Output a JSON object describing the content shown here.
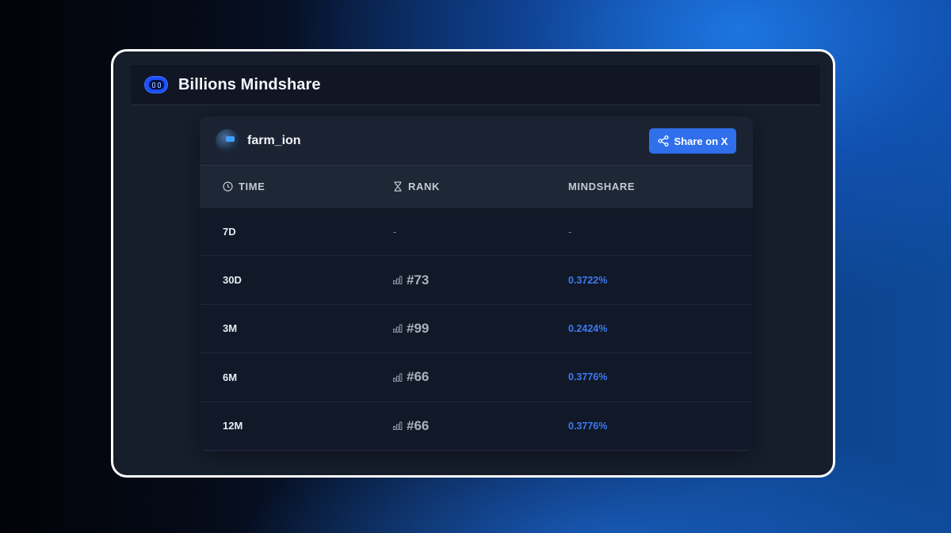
{
  "app": {
    "title": "Billions Mindshare",
    "logo_icon": "robot-eyes-logo"
  },
  "profile": {
    "username": "farm_ion",
    "share_label": "Share on X"
  },
  "table": {
    "headers": {
      "time": "TIME",
      "rank": "RANK",
      "mindshare": "MINDSHARE"
    },
    "rows": [
      {
        "time": "7D",
        "rank": "-",
        "mindshare": "-"
      },
      {
        "time": "30D",
        "rank": "#73",
        "mindshare": "0.3722%"
      },
      {
        "time": "3M",
        "rank": "#99",
        "mindshare": "0.2424%"
      },
      {
        "time": "6M",
        "rank": "#66",
        "mindshare": "0.3776%"
      },
      {
        "time": "12M",
        "rank": "#66",
        "mindshare": "0.3776%"
      }
    ]
  },
  "colors": {
    "accent": "#2f6fec",
    "mindshare_text": "#3d7bf0",
    "frame_border": "#ffffff"
  }
}
